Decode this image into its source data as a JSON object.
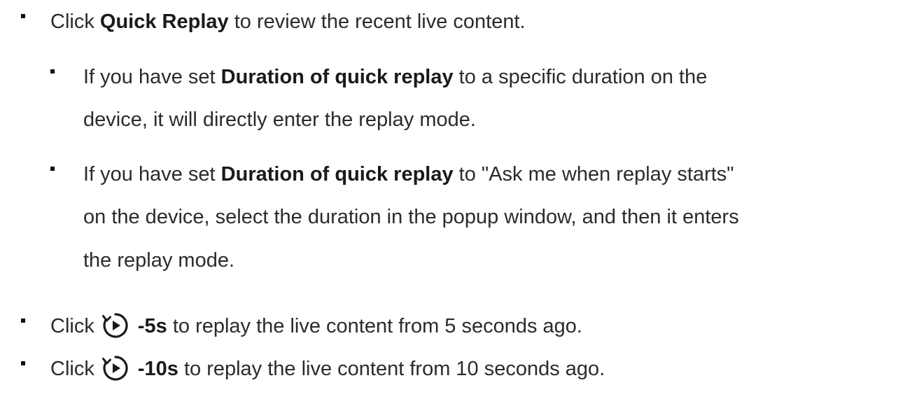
{
  "items": [
    {
      "pre": "Click ",
      "bold": "Quick Replay",
      "post": " to review the recent live content."
    },
    {
      "pre": "If you have set ",
      "bold": "Duration of quick replay",
      "post": " to a specific duration on the",
      "line2": "device, it will directly enter the replay mode."
    },
    {
      "pre": "If you have set ",
      "bold": "Duration of quick replay",
      "post": " to \"Ask me when replay starts\"",
      "line2": "on the device, select the duration in the popup window, and then it enters",
      "line3": "the replay mode."
    },
    {
      "pre": "Click",
      "icon": "replay-icon",
      "bold": "-5s",
      "post": " to replay the live content from 5 seconds ago."
    },
    {
      "pre": "Click",
      "icon": "replay-icon",
      "bold": "-10s",
      "post": " to replay the live content from 10 seconds ago."
    }
  ]
}
